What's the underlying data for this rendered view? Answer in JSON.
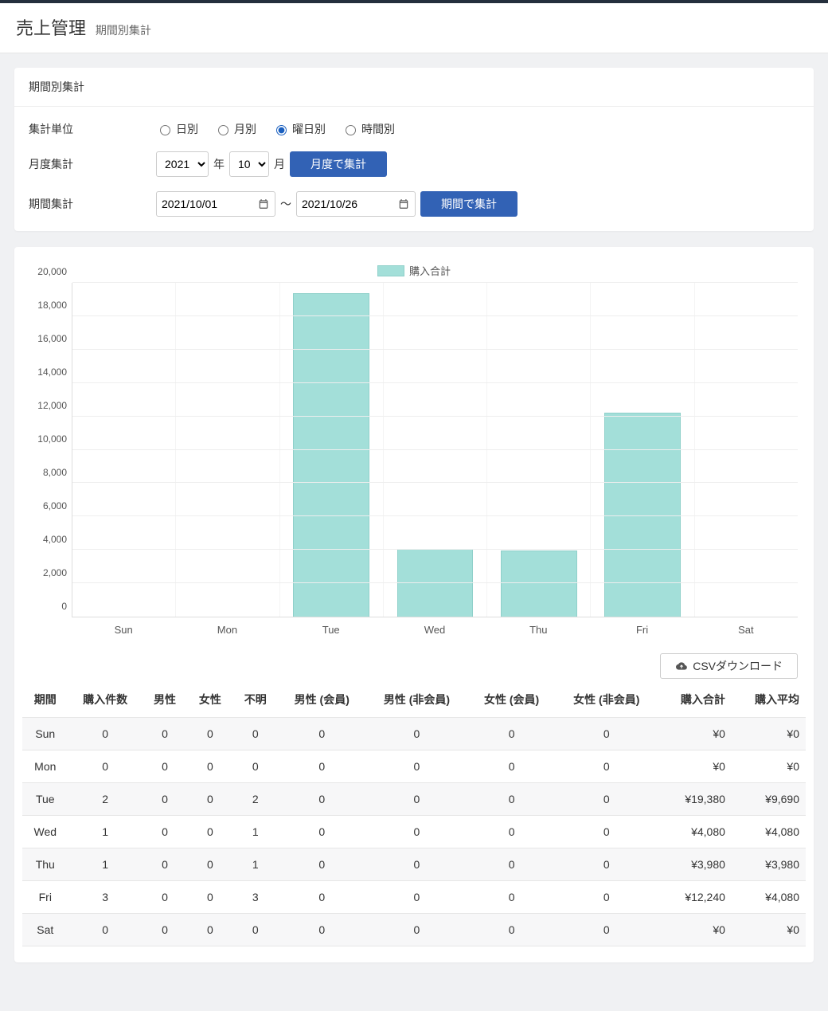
{
  "header": {
    "title": "売上管理",
    "subtitle": "期間別集計"
  },
  "filter": {
    "panel_title": "期間別集計",
    "unit_label": "集計単位",
    "unit_options": {
      "daily": "日別",
      "monthly": "月別",
      "weekday": "曜日別",
      "hourly": "時間別"
    },
    "unit_selected": "weekday",
    "month_agg_label": "月度集計",
    "year_value": "2021",
    "year_suffix": "年",
    "month_value": "10",
    "month_suffix": "月",
    "month_button": "月度で集計",
    "period_agg_label": "期間集計",
    "date_from": "2021/10/01",
    "date_sep": "〜",
    "date_to": "2021/10/26",
    "period_button": "期間で集計"
  },
  "chart_data": {
    "type": "bar",
    "legend": "購入合計",
    "categories": [
      "Sun",
      "Mon",
      "Tue",
      "Wed",
      "Thu",
      "Fri",
      "Sat"
    ],
    "values": [
      0,
      0,
      19380,
      4080,
      3980,
      12240,
      0
    ],
    "ylim": [
      0,
      20000
    ],
    "ystep": 2000,
    "y_ticks": [
      "0",
      "2,000",
      "4,000",
      "6,000",
      "8,000",
      "10,000",
      "12,000",
      "14,000",
      "16,000",
      "18,000",
      "20,000"
    ]
  },
  "csv_button": "CSVダウンロード",
  "table": {
    "headers": [
      "期間",
      "購入件数",
      "男性",
      "女性",
      "不明",
      "男性 (会員)",
      "男性 (非会員)",
      "女性 (会員)",
      "女性 (非会員)",
      "購入合計",
      "購入平均"
    ],
    "rows": [
      {
        "period": "Sun",
        "count": "0",
        "male": "0",
        "female": "0",
        "unknown": "0",
        "male_m": "0",
        "male_nm": "0",
        "female_m": "0",
        "female_nm": "0",
        "total": "¥0",
        "avg": "¥0"
      },
      {
        "period": "Mon",
        "count": "0",
        "male": "0",
        "female": "0",
        "unknown": "0",
        "male_m": "0",
        "male_nm": "0",
        "female_m": "0",
        "female_nm": "0",
        "total": "¥0",
        "avg": "¥0"
      },
      {
        "period": "Tue",
        "count": "2",
        "male": "0",
        "female": "0",
        "unknown": "2",
        "male_m": "0",
        "male_nm": "0",
        "female_m": "0",
        "female_nm": "0",
        "total": "¥19,380",
        "avg": "¥9,690"
      },
      {
        "period": "Wed",
        "count": "1",
        "male": "0",
        "female": "0",
        "unknown": "1",
        "male_m": "0",
        "male_nm": "0",
        "female_m": "0",
        "female_nm": "0",
        "total": "¥4,080",
        "avg": "¥4,080"
      },
      {
        "period": "Thu",
        "count": "1",
        "male": "0",
        "female": "0",
        "unknown": "1",
        "male_m": "0",
        "male_nm": "0",
        "female_m": "0",
        "female_nm": "0",
        "total": "¥3,980",
        "avg": "¥3,980"
      },
      {
        "period": "Fri",
        "count": "3",
        "male": "0",
        "female": "0",
        "unknown": "3",
        "male_m": "0",
        "male_nm": "0",
        "female_m": "0",
        "female_nm": "0",
        "total": "¥12,240",
        "avg": "¥4,080"
      },
      {
        "period": "Sat",
        "count": "0",
        "male": "0",
        "female": "0",
        "unknown": "0",
        "male_m": "0",
        "male_nm": "0",
        "female_m": "0",
        "female_nm": "0",
        "total": "¥0",
        "avg": "¥0"
      }
    ]
  }
}
